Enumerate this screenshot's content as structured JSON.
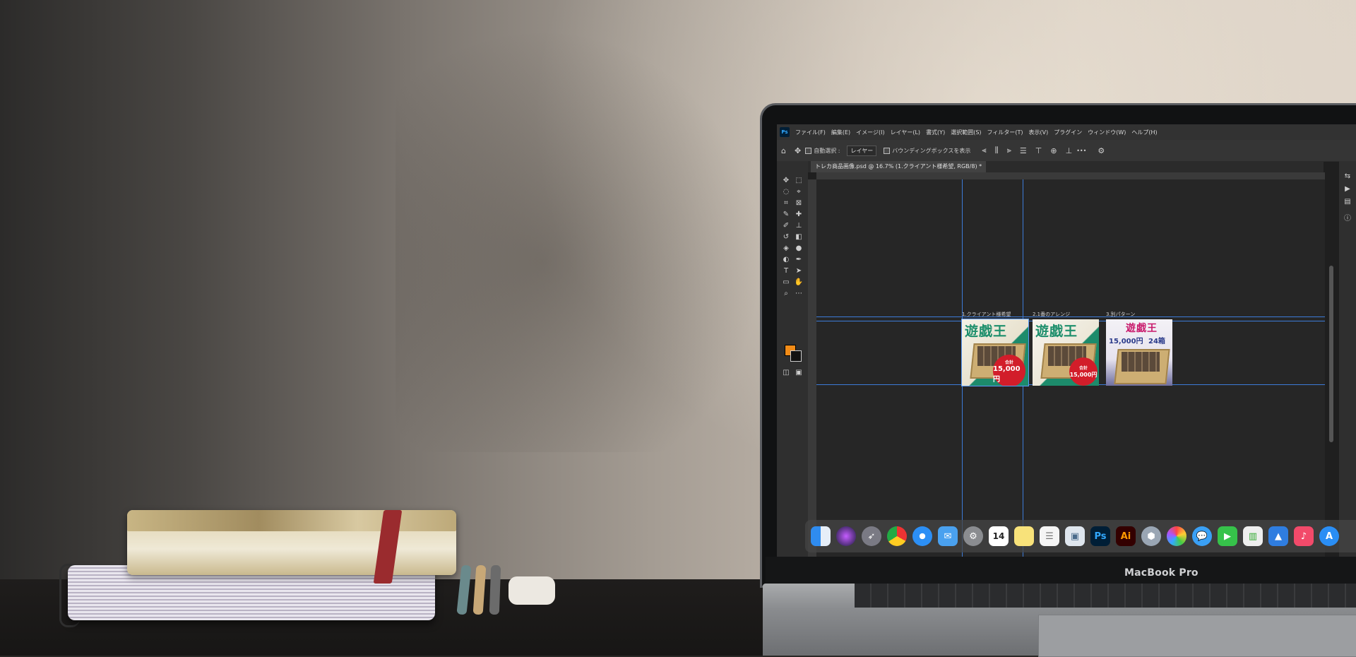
{
  "laptop": {
    "brand": "MacBook Pro"
  },
  "photoshop": {
    "app_icon": "Ps",
    "menu": [
      "ファイル(F)",
      "編集(E)",
      "イメージ(I)",
      "レイヤー(L)",
      "書式(Y)",
      "選択範囲(S)",
      "フィルター(T)",
      "表示(V)",
      "プラグイン",
      "ウィンドウ(W)",
      "ヘルプ(H)"
    ],
    "options": {
      "auto_select_label": "自動選択 :",
      "auto_select_value": "レイヤー",
      "bounding_box_label": "バウンディングボックスを表示",
      "more": "•••"
    },
    "document_tab": "トレカ商品画像.psd @ 16.7% (1.クライアント様希望, RGB/8) *",
    "foreground_color": "#f28c18",
    "background_color": "#111111",
    "artboards": [
      {
        "label": "1.クライアント様希望",
        "title": "遊戯王",
        "badge_line1": "合計",
        "badge_line2": "15,000円"
      },
      {
        "label": "2.1番のアレンジ",
        "title": "遊戯王",
        "badge_line1": "合計",
        "badge_line2": "15,000円"
      },
      {
        "label": "3.別パターン",
        "title": "遊戯王",
        "price1": "15,000円",
        "price2": "24箱"
      }
    ]
  },
  "dock": {
    "icons": [
      "finder-icon",
      "siri-icon",
      "launchpad-icon",
      "chrome-icon",
      "safari-icon",
      "mail-icon",
      "system-preferences-icon",
      "calendar-icon",
      "notes-icon",
      "reminders-icon",
      "preview-icon",
      "photoshop-icon",
      "illustrator-icon",
      "app-icon",
      "photos-icon",
      "messages-icon",
      "facetime-icon",
      "numbers-icon",
      "keynote-icon",
      "music-icon",
      "app-store-icon"
    ],
    "calendar_day": "14",
    "ps_label": "Ps",
    "ai_label": "Ai"
  }
}
